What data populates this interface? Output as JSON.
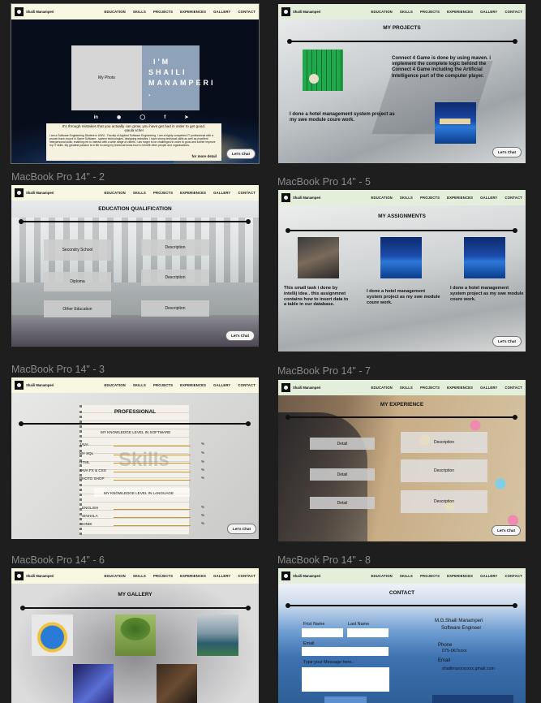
{
  "nav": {
    "brand": "Shaili Manamperi",
    "items": [
      "EDUCATION",
      "SKILLS",
      "PROJECTS",
      "EXPERIENCES",
      "GALLERY",
      "CONTACT"
    ]
  },
  "chat_label": "Let's Chat",
  "frame_labels": {
    "f2": "MacBook Pro 14\" - 2",
    "f5": "MacBook Pro 14\" - 5",
    "f3": "MacBook Pro 14\" - 3",
    "f7": "MacBook Pro 14\" - 7",
    "f6": "MacBook Pro 14\" - 6",
    "f8": "MacBook Pro 14\" - 8"
  },
  "home": {
    "photo_label": "My Photo",
    "intro_lines": [
      "I'M",
      "SHAILI",
      "MANAMPERI ."
    ],
    "social_icons": [
      "linkedin-icon",
      "github-icon",
      "instagram-icon",
      "facebook-icon",
      "twitter-icon"
    ],
    "quote": "It's through mistakes that you actually can grow, you have get bad in order to get good.",
    "quote_author": "-paula scher",
    "about": "I am a Software Engineering Student in UWU - Faculty of Applied Software Engineering. I am a highly competent IT professional with a proven track record in Game Software , system technologies, designing websites. I have strong technical skills as well as excellent interpersonal skills, enabling me to interact with a wide range of clients. I am eager to be challenged in order to grow and further improve my IT skills. My greatest passion is in life is using my technical know-how to benefit other people and organisations.",
    "more": "for more detail"
  },
  "projects": {
    "title": "MY PROJECTS",
    "p1": "Connect 4 Game is done by using maven. i implement the complete logic behind the Connect 4 Game including the Artificial Intelligence part of the computer player.",
    "p2": "I done a hotel management system project as my swe module coure work."
  },
  "education": {
    "title": "EDUCATION QUALIFICATION",
    "items": [
      "Secondry School",
      "Diploma",
      "Other Education"
    ],
    "desc": "Description"
  },
  "assignments": {
    "title": "MY ASSIGNMENTS",
    "items": [
      "This small task i done by intellij idea . this assignmnet contains how to insert data to a table in our database.",
      "I done a hotel management system project as my swe module coure work.",
      "I done a hotel management system project as my swe module coure work."
    ]
  },
  "skills": {
    "title": "PROFESSIONAL",
    "software_heading": "MY KNOWLEDGE LEVEL IN SOFTWARE",
    "software": [
      "JAVA",
      "MY SQL",
      "HTML",
      "JAVA FX & CSS",
      "PHOTO SHOP"
    ],
    "language_heading": "MY KNOWLEDGE LEVEL IN LANGUAGE",
    "languages": [
      "ENGLISH",
      "SINHALA",
      "HINDI"
    ],
    "pct_symbol": "%",
    "watermark": "Skills"
  },
  "experience": {
    "title": "MY EXPERIENCE",
    "detail": "Detail",
    "desc": "Description"
  },
  "gallery": {
    "title": "MY GALLERY",
    "images": [
      "parrot",
      "tree",
      "lake",
      "handshake",
      "laptop"
    ]
  },
  "contact": {
    "title": "CONTACT",
    "first_name": "Frist Name",
    "last_name": "Last Name",
    "email": "Email",
    "message": "Type your Message here..",
    "name": "M.G.Shaili Manamperi",
    "role": "Software Engineer",
    "phone_label": "Phone",
    "phone": "075-067xxxx",
    "email_label": "Email",
    "email_value": "shailimanxxxxxx.gmail.com"
  },
  "colors": {
    "canvas": "#1e1e1e",
    "nav_cream": "#f8f7e1",
    "nav_green": "#e3eedb",
    "label_gray": "#8a8a8a",
    "skill_bar": "#c59a2a"
  }
}
